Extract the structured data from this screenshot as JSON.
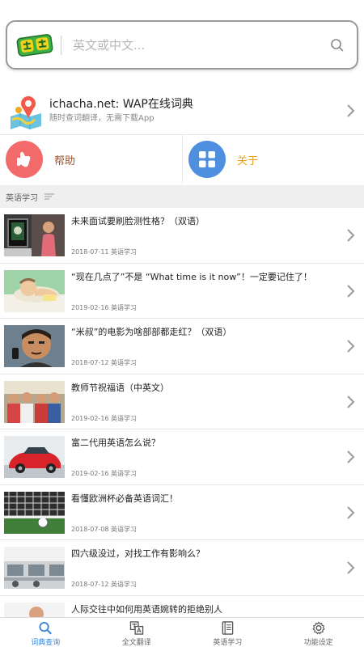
{
  "search": {
    "placeholder": "英文或中文..."
  },
  "promo": {
    "title": "ichacha.net: WAP在线词典",
    "subtitle": "随时查词翻译，无需下载App"
  },
  "quick_links": {
    "help_label": "帮助",
    "help_color": "#a0522d",
    "about_label": "关于",
    "about_color": "#e8a21a"
  },
  "section": {
    "title": "英语学习"
  },
  "articles": [
    {
      "title": "未来面试要刷脸测性格？（双语）",
      "date": "2018-07-11",
      "category": "英语学习",
      "meta": "2018-07-11 英语学习"
    },
    {
      "title": "“现在几点了”不是 “What time is it now”！一定要记住了！",
      "date": "2019-02-16",
      "category": "英语学习",
      "meta": "2019-02-16 英语学习"
    },
    {
      "title": "“米叔”的电影为啥部部都走红？（双语）",
      "date": "2018-07-12",
      "category": "英语学习",
      "meta": "2018-07-12 英语学习"
    },
    {
      "title": "教师节祝福语（中英文）",
      "date": "2019-02-16",
      "category": "英语学习",
      "meta": "2019-02-16 英语学习"
    },
    {
      "title": "富二代用英语怎么说？",
      "date": "2019-02-16",
      "category": "英语学习",
      "meta": "2019-02-16 英语学习"
    },
    {
      "title": "看懂欧洲杯必备英语词汇！",
      "date": "2018-07-08",
      "category": "英语学习",
      "meta": "2018-07-08 英语学习"
    },
    {
      "title": "四六级没过，对找工作有影响么？",
      "date": "2018-07-12",
      "category": "英语学习",
      "meta": "2018-07-12 英语学习"
    },
    {
      "title": "人际交往中如何用英语婉转的拒绝别人",
      "date": "",
      "category": "",
      "meta": ""
    }
  ],
  "tabs": [
    {
      "label": "词典查询",
      "icon": "search-icon",
      "active": true
    },
    {
      "label": "全文翻译",
      "icon": "translate-icon",
      "active": false
    },
    {
      "label": "英语学习",
      "icon": "book-icon",
      "active": false
    },
    {
      "label": "功能设定",
      "icon": "gear-icon",
      "active": false
    }
  ],
  "colors": {
    "accent": "#3d86d6",
    "help_circle": "#f26a6a",
    "about_circle": "#4e8fe0",
    "logo_green": "#3cb043",
    "logo_yellow": "#f2d21b"
  }
}
